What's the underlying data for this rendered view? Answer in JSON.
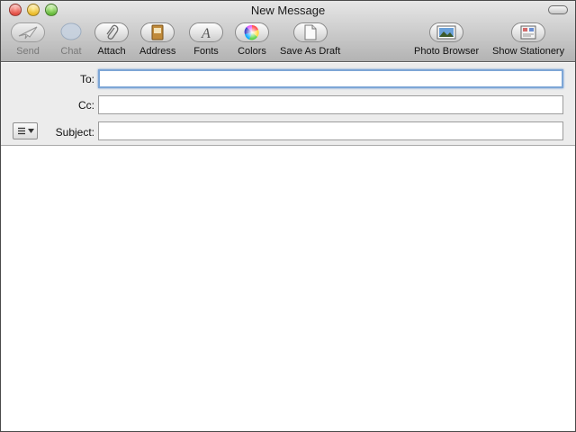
{
  "window": {
    "title": "New Message"
  },
  "toolbar": {
    "send": {
      "label": "Send",
      "icon": "paper-plane-icon",
      "enabled": false
    },
    "chat": {
      "label": "Chat",
      "icon": "speech-bubble-icon",
      "enabled": false
    },
    "attach": {
      "label": "Attach",
      "icon": "paperclip-icon",
      "enabled": true
    },
    "address": {
      "label": "Address",
      "icon": "address-book-icon",
      "enabled": true
    },
    "fonts": {
      "label": "Fonts",
      "icon": "font-a-icon",
      "enabled": true
    },
    "colors": {
      "label": "Colors",
      "icon": "color-wheel-icon",
      "enabled": true
    },
    "save_draft": {
      "label": "Save As Draft",
      "icon": "document-icon",
      "enabled": true
    },
    "photo_browser": {
      "label": "Photo Browser",
      "icon": "photo-icon",
      "enabled": true
    },
    "show_stationery": {
      "label": "Show Stationery",
      "icon": "stationery-icon",
      "enabled": true
    }
  },
  "header": {
    "to": {
      "label": "To:",
      "value": ""
    },
    "cc": {
      "label": "Cc:",
      "value": ""
    },
    "subject": {
      "label": "Subject:",
      "value": ""
    },
    "account_menu_icon": "list-menu-icon"
  },
  "body": {
    "text": ""
  },
  "colors": {
    "focus_ring": "#7da6d6",
    "toolbar_gradient_top": "#e6e6e6",
    "toolbar_gradient_bottom": "#b3b3b3",
    "header_bg": "#ececec"
  }
}
